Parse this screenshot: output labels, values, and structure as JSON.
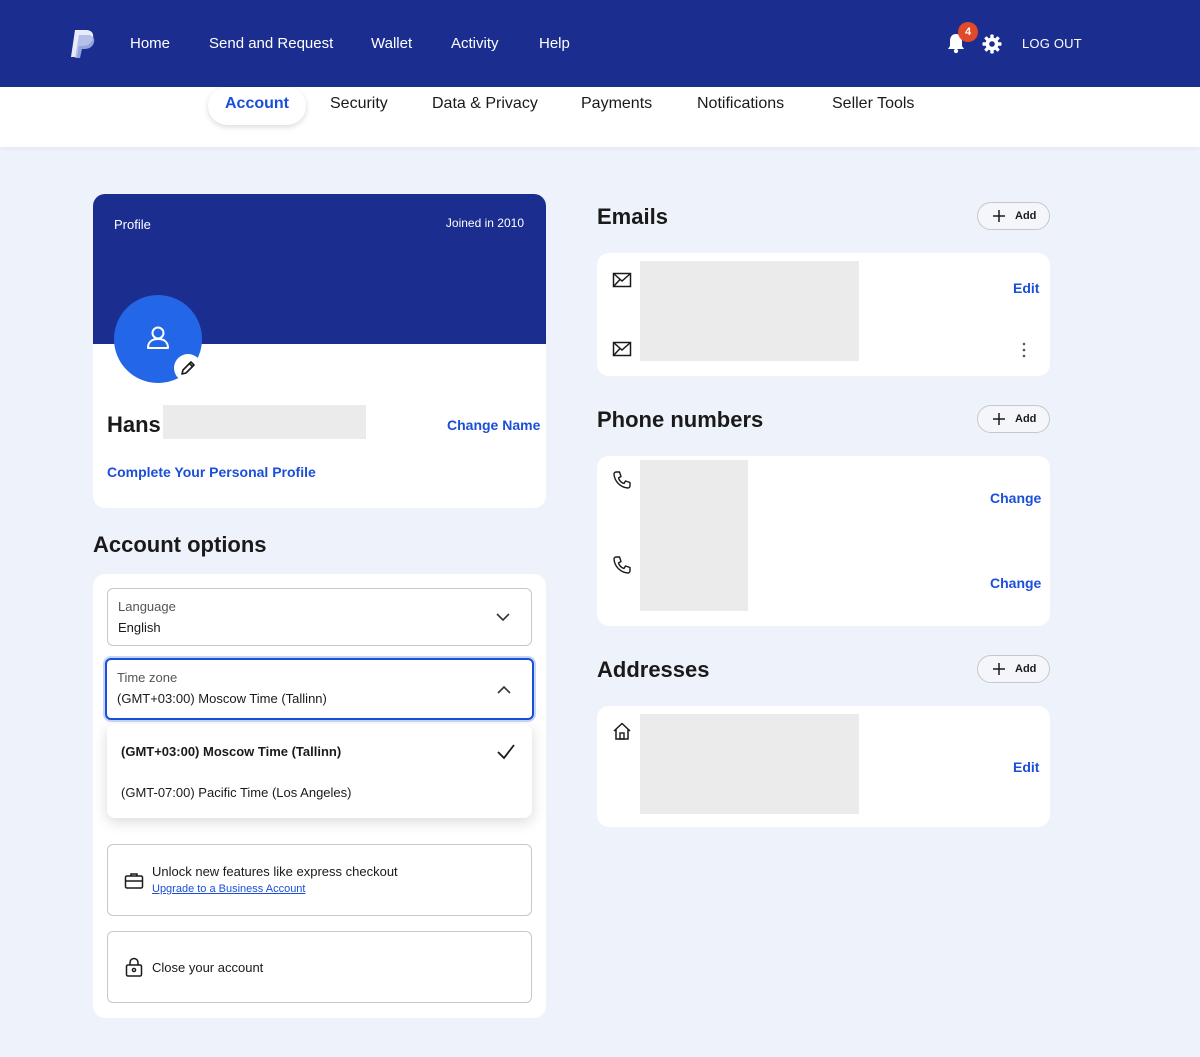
{
  "nav": {
    "links": [
      "Home",
      "Send and Request",
      "Wallet",
      "Activity",
      "Help"
    ],
    "notifications_count": "4",
    "logout": "LOG OUT"
  },
  "tabs": [
    "Account",
    "Security",
    "Data & Privacy",
    "Payments",
    "Notifications",
    "Seller Tools"
  ],
  "profile": {
    "label": "Profile",
    "joined": "Joined in 2010",
    "first_name": "Hans",
    "change_name": "Change Name",
    "complete_profile": "Complete Your Personal Profile"
  },
  "account_options": {
    "title": "Account options",
    "language": {
      "label": "Language",
      "value": "English"
    },
    "timezone": {
      "label": "Time zone",
      "value": "(GMT+03:00) Moscow Time (Tallinn)",
      "options": [
        "(GMT+03:00) Moscow Time (Tallinn)",
        "(GMT-07:00) Pacific Time (Los Angeles)"
      ]
    },
    "upgrade": {
      "text": "Unlock new features like express checkout",
      "link": "Upgrade to a Business Account"
    },
    "close_account": "Close your account"
  },
  "emails": {
    "title": "Emails",
    "add": "Add",
    "edit": "Edit"
  },
  "phones": {
    "title": "Phone numbers",
    "add": "Add",
    "change_1": "Change",
    "change_2": "Change"
  },
  "addresses": {
    "title": "Addresses",
    "add": "Add",
    "edit": "Edit"
  },
  "colors": {
    "nav_bg": "#1b2d8f",
    "accent": "#1b4fd8",
    "avatar": "#2466e8",
    "badge": "#e04a2a",
    "page_bg": "#eef2fa"
  }
}
